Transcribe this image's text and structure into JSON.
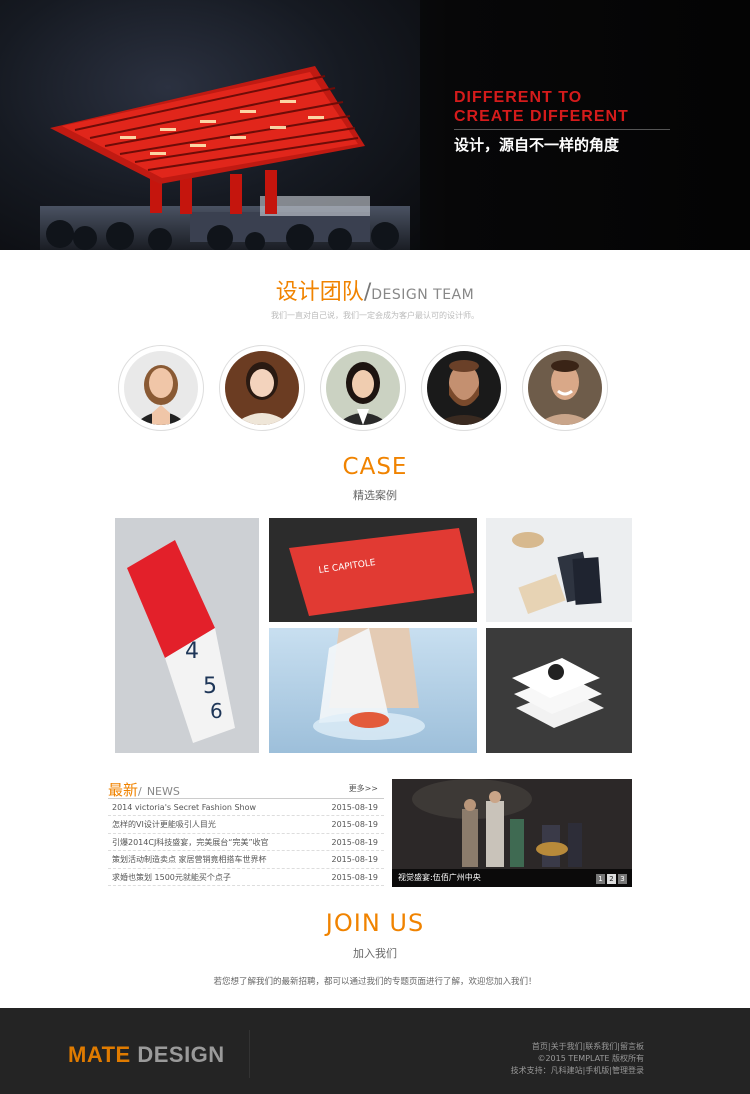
{
  "hero": {
    "title_line1": "DIFFERENT TO",
    "title_line2": "CREATE DIFFERENT",
    "subtitle": "设计，源自不一样的角度",
    "accent_color": "#d51b1b"
  },
  "team": {
    "title_cn": "设计团队",
    "slash": "/",
    "title_en": "DESIGN TEAM",
    "subtitle": "我们一直对自己说，我们一定会成为客户最认可的设计师。",
    "members": [
      "member-1",
      "member-2",
      "member-3",
      "member-4",
      "member-5"
    ]
  },
  "cases": {
    "title": "CASE",
    "subtitle": "精选案例"
  },
  "news": {
    "title_cn": "最新",
    "slash": "/",
    "title_en": "NEWS",
    "more": "更多>>",
    "items": [
      {
        "title": "2014 victoria's Secret Fashion Show",
        "date": "2015-08-19"
      },
      {
        "title": "怎样的VI设计更能吸引人目光",
        "date": "2015-08-19"
      },
      {
        "title": "引爆2014CJ科技盛宴，完美展台“完美”收官",
        "date": "2015-08-19"
      },
      {
        "title": "策划活动制造卖点 家居营销竟相搭车世界杯",
        "date": "2015-08-19"
      },
      {
        "title": "求婚也策划 1500元就能买个点子",
        "date": "2015-08-19"
      }
    ]
  },
  "slider": {
    "caption": "视觉盛宴:伍佰广州中央",
    "pages": [
      "1",
      "2",
      "3"
    ],
    "active_page": "2"
  },
  "join": {
    "title": "JOIN US",
    "subtitle": "加入我们",
    "text": "若您想了解我们的最新招聘，都可以通过我们的专题页面进行了解，欢迎您加入我们！"
  },
  "footer": {
    "logo_part1": "MATE",
    "logo_part2": "DESIGN",
    "links": [
      "首页",
      "关于我们",
      "联系我们",
      "留言板"
    ],
    "copyright": "©2015 TEMPLATE 版权所有",
    "support_label": "技术支持：",
    "support_links": [
      "凡科建站",
      "手机版",
      "管理登录"
    ],
    "logo_colors": {
      "accent": "#e07b00",
      "muted": "#9a9a9a"
    }
  }
}
